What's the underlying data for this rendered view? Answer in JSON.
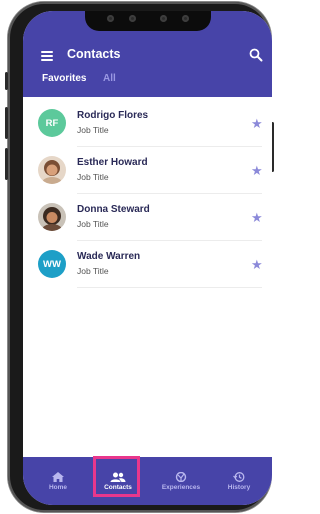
{
  "header": {
    "title": "Contacts",
    "tabs": [
      {
        "label": "Favorites",
        "active": true
      },
      {
        "label": "All",
        "active": false
      }
    ],
    "background_color": "#4744a8"
  },
  "contacts": [
    {
      "name": "Rodrigo Flores",
      "subtitle": "Job Title",
      "initials": "RF",
      "avatar_color": "#5cc99b",
      "favorite": true
    },
    {
      "name": "Esther Howard",
      "subtitle": "Job Title",
      "initials": "",
      "avatar_color": "#b07a5a",
      "favorite": true
    },
    {
      "name": "Donna Steward",
      "subtitle": "Job Title",
      "initials": "",
      "avatar_color": "#8a5a3c",
      "favorite": true
    },
    {
      "name": "Wade Warren",
      "subtitle": "Job Title",
      "initials": "WW",
      "avatar_color": "#1d9fc7",
      "favorite": true
    }
  ],
  "bottom_nav": [
    {
      "label": "Home",
      "icon": "home-icon",
      "active": false
    },
    {
      "label": "Contacts",
      "icon": "contacts-icon",
      "active": true
    },
    {
      "label": "Experiences",
      "icon": "experiences-icon",
      "active": false
    },
    {
      "label": "History",
      "icon": "history-icon",
      "active": false
    }
  ],
  "colors": {
    "accent": "#4744a8",
    "star": "#8b89d9",
    "highlight": "#e8378c"
  }
}
